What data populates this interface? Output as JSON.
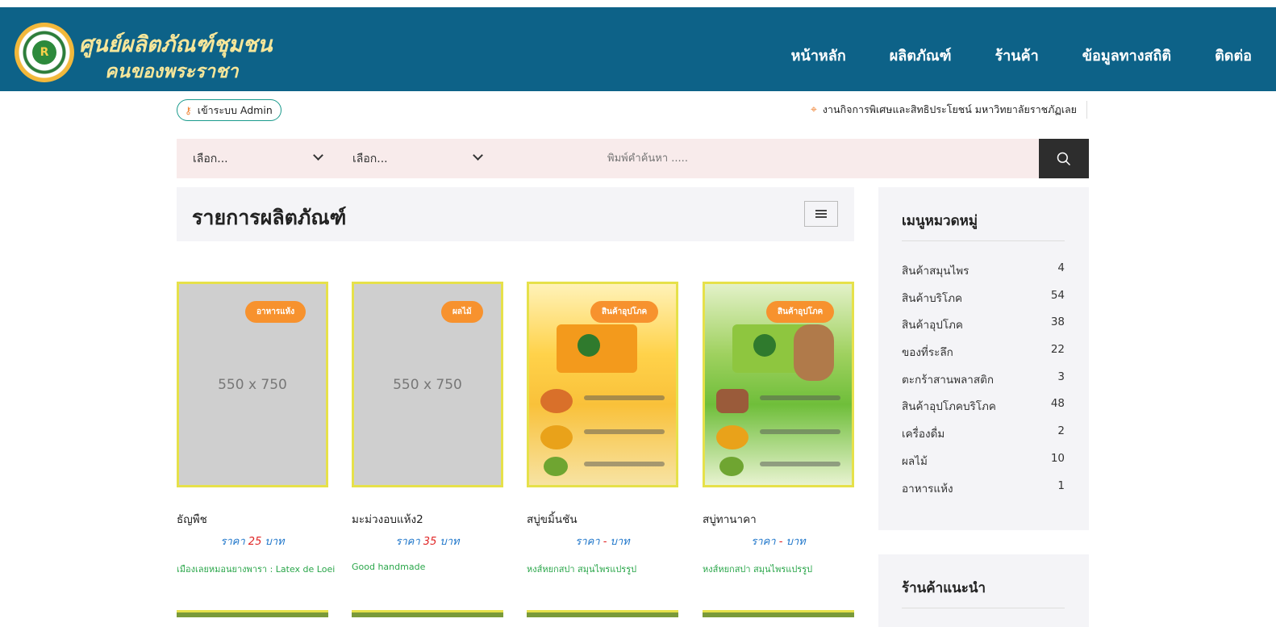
{
  "brand": {
    "line1": "ศูนย์ผลิตภัณฑ์ชุมชน",
    "line2": "คนของพระราชา",
    "logo_text": "R"
  },
  "nav": [
    {
      "label": "หน้าหลัก"
    },
    {
      "label": "ผลิตภัณฑ์"
    },
    {
      "label": "ร้านค้า"
    },
    {
      "label": "ข้อมูลทางสถิติ"
    },
    {
      "label": "ติดต่อ"
    }
  ],
  "admin": {
    "label": "เข้าระบบ Admin",
    "icon": "key-icon"
  },
  "org": {
    "label": "งานกิจการพิเศษและสิทธิประโยชน์ มหาวิทยาลัยราชภัฏเลย",
    "icon": "map-pin-icon"
  },
  "search": {
    "select1": "เลือก...",
    "select2": "เลือก...",
    "placeholder": "พิมพ์คำค้นหา .....",
    "icon": "search-icon"
  },
  "list": {
    "title": "รายการผลิตภัณฑ์",
    "view_icon": "list-view-icon"
  },
  "products": [
    {
      "badge": "อาหารแห้ง",
      "name": "ธัญพืช",
      "price_prefix": "ราคา",
      "price": "25",
      "price_suffix": "บาท",
      "shop": "เมืองเลยหมอนยางพารา : Latex de Loei",
      "placeholder": "550 x 750"
    },
    {
      "badge": "ผลไม้",
      "name": "มะม่วงอบแห้ง2",
      "price_prefix": "ราคา",
      "price": "35",
      "price_suffix": "บาท",
      "shop": "Good handmade",
      "placeholder": "550 x 750"
    },
    {
      "badge": "สินค้าอุปโภค",
      "name": "สบู่ขมิ้นชัน",
      "price_prefix": "ราคา",
      "price": "-",
      "price_suffix": "บาท",
      "shop": "หงส์หยกสปา สมุนไพรแปรรูป"
    },
    {
      "badge": "สินค้าอุปโภค",
      "name": "สบู่ทานาคา",
      "price_prefix": "ราคา",
      "price": "-",
      "price_suffix": "บาท",
      "shop": "หงส์หยกสปา สมุนไพรแปรรูป"
    }
  ],
  "categories": {
    "title": "เมนูหมวดหมู่",
    "items": [
      {
        "label": "สินค้าสมุนไพร",
        "count": "4"
      },
      {
        "label": "สินค้าบริโภค",
        "count": "54"
      },
      {
        "label": "สินค้าอุปโภค",
        "count": "38"
      },
      {
        "label": "ของที่ระลึก",
        "count": "22"
      },
      {
        "label": "ตะกร้าสานพลาสติก",
        "count": "3"
      },
      {
        "label": "สินค้าอุปโภคบริโภค",
        "count": "48"
      },
      {
        "label": "เครื่องดื่ม",
        "count": "2"
      },
      {
        "label": "ผลไม้",
        "count": "10"
      },
      {
        "label": "อาหารแห้ง",
        "count": "1"
      }
    ]
  },
  "recommended": {
    "title": "ร้านค้าแนะนำ"
  },
  "colors": {
    "header": "#0d6288",
    "badge": "#f7922e",
    "price": "#1a73c9",
    "price_num": "#e02424",
    "shop": "#2aa64a"
  }
}
